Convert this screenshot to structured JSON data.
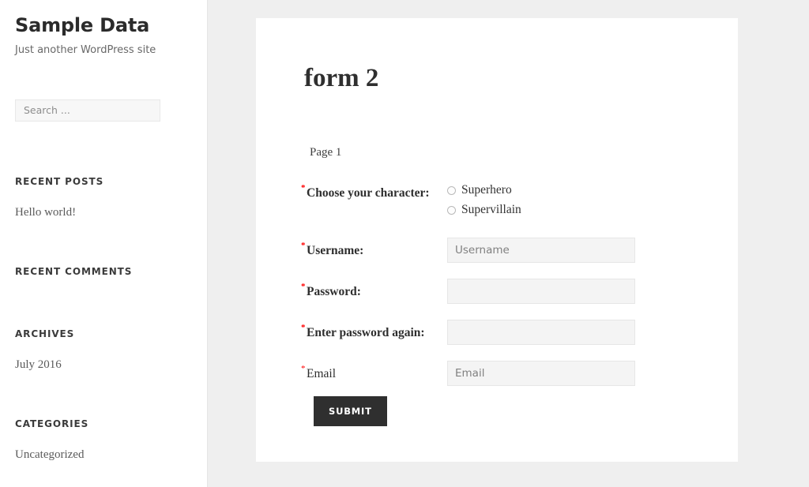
{
  "site": {
    "title": "Sample Data",
    "description": "Just another WordPress site"
  },
  "search": {
    "placeholder": "Search ...",
    "value": ""
  },
  "sidebar": {
    "widgets": [
      {
        "title": "Recent Posts",
        "items": [
          "Hello world!"
        ]
      },
      {
        "title": "Recent Comments",
        "items": []
      },
      {
        "title": "Archives",
        "items": [
          "July 2016"
        ]
      },
      {
        "title": "Categories",
        "items": [
          "Uncategorized"
        ]
      }
    ]
  },
  "form": {
    "title": "form 2",
    "page_label": "Page 1",
    "required_marker": "*",
    "required_color": "#ff0000",
    "rows": [
      {
        "label": "Choose your character:",
        "required": true,
        "type": "radio",
        "options": [
          "Superhero",
          "Supervillain"
        ],
        "selected": ""
      },
      {
        "label": "Username:",
        "required": true,
        "type": "text",
        "placeholder": "Username",
        "value": ""
      },
      {
        "label": "Password:",
        "required": true,
        "type": "password",
        "placeholder": "",
        "value": ""
      },
      {
        "label": "Enter password again:",
        "required": true,
        "type": "password",
        "placeholder": "",
        "value": ""
      },
      {
        "label": "Email",
        "required": true,
        "type": "text",
        "placeholder": "Email",
        "value": ""
      }
    ],
    "submit_label": "Submit"
  },
  "colors": {
    "page_background": "#efefef",
    "card_background": "#ffffff",
    "button": "#2f2f2f",
    "input_background": "#f4f4f4"
  }
}
